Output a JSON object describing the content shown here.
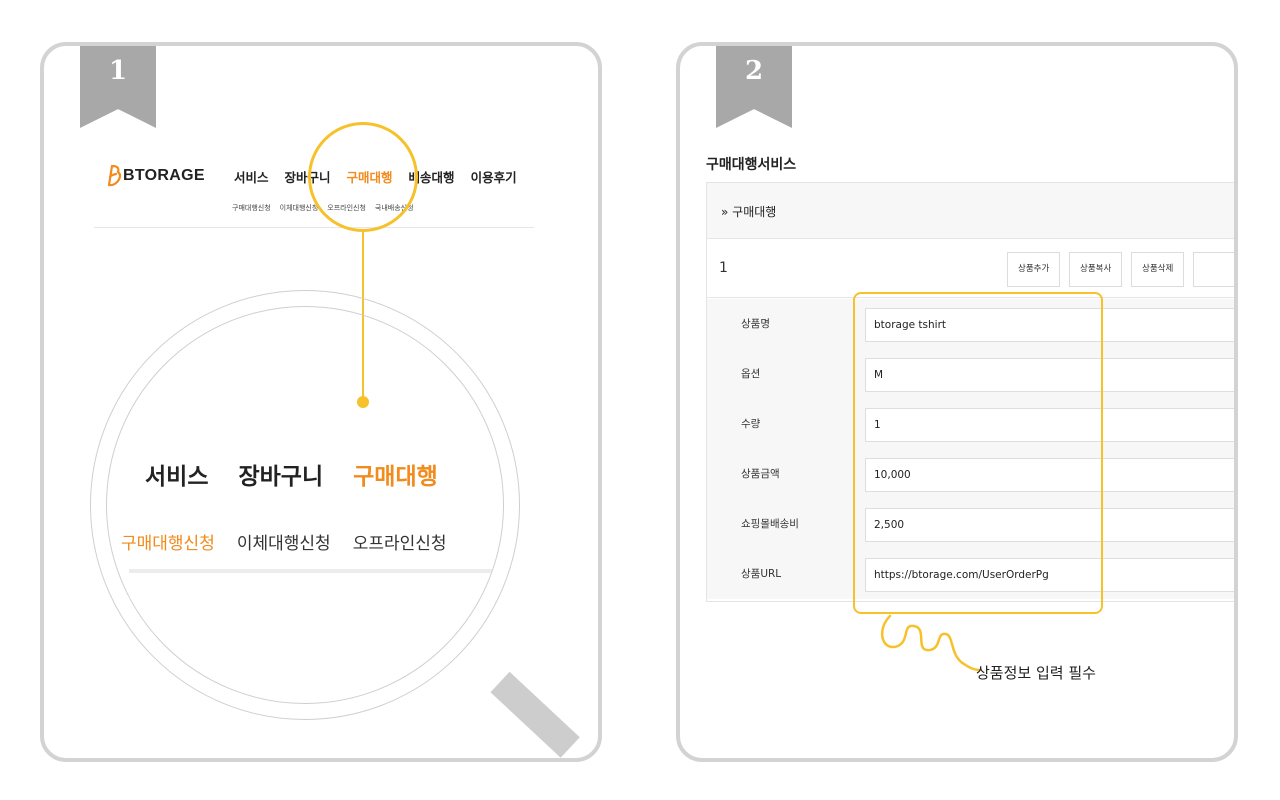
{
  "panel1": {
    "step": "1",
    "logo_text": "BTORAGE",
    "menu": [
      "서비스",
      "장바구니",
      "구매대행",
      "배송대행",
      "이용후기"
    ],
    "submenu": [
      "구매대행신청",
      "이체대행신청",
      "오프라인신청",
      "국내배송신청"
    ],
    "zoom_menu": [
      "서비스",
      "장바구니",
      "구매대행"
    ],
    "zoom_submenu": [
      "구매대행신청",
      "이체대행신청",
      "오프라인신청"
    ],
    "accent_color": "#f28a1c",
    "highlight_color": "#f6c12b"
  },
  "panel2": {
    "step": "2",
    "title": "구매대행서비스",
    "section_label": "» 구매대행",
    "item_number": "1",
    "buttons": [
      "상품추가",
      "상품복사",
      "상품삭제"
    ],
    "fields": [
      {
        "label": "상품명",
        "value": "btorage tshirt"
      },
      {
        "label": "옵션",
        "value": "M"
      },
      {
        "label": "수량",
        "value": "1"
      },
      {
        "label": "상품금액",
        "value": "10,000"
      },
      {
        "label": "쇼핑몰배송비",
        "value": "2,500"
      },
      {
        "label": "상품URL",
        "value": "https://btorage.com/UserOrderPg"
      }
    ],
    "note": "상품정보 입력 필수"
  }
}
